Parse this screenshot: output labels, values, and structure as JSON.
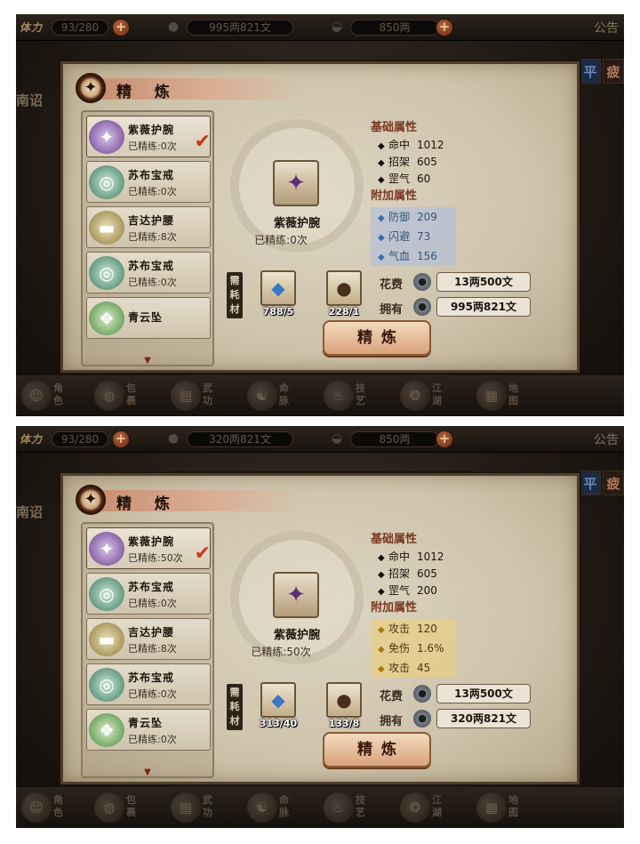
{
  "shots": [
    {
      "topbar": {
        "stamina_label": "体力",
        "stamina": "93/280",
        "money": "995两821文",
        "ingot": "850两",
        "notice": "公告"
      },
      "side_tabs": [
        "平",
        "疲"
      ],
      "left_edge": "南诏",
      "panel": {
        "title": "精 炼",
        "list": [
          {
            "name": "紫薇护腕",
            "count": "已精练:0次",
            "icon": "bracer-icon"
          },
          {
            "name": "苏布宝戒",
            "count": "已精练:0次",
            "icon": "ring-icon"
          },
          {
            "name": "吉达护腰",
            "count": "已精练:8次",
            "icon": "belt-icon"
          },
          {
            "name": "苏布宝戒",
            "count": "已精练:0次",
            "icon": "ring-icon"
          },
          {
            "name": "青云坠",
            "count": "",
            "icon": "pendant-icon"
          }
        ],
        "detail": {
          "name": "紫薇护腕",
          "count": "已精练:0次"
        },
        "base_heading": "基础属性",
        "base_attrs": [
          {
            "label": "命中",
            "value": "1012"
          },
          {
            "label": "招架",
            "value": "605"
          },
          {
            "label": "罡气",
            "value": "60"
          }
        ],
        "bonus_heading": "附加属性",
        "bonus_attrs": [
          {
            "label": "防御",
            "value": "209"
          },
          {
            "label": "闪避",
            "value": "73"
          },
          {
            "label": "气血",
            "value": "156"
          }
        ],
        "materials_label": "需耗材",
        "materials": [
          {
            "qty": "788/5",
            "icon": "crystal-icon"
          },
          {
            "qty": "228/1",
            "icon": "pouch-icon"
          }
        ],
        "cost_label": "花费",
        "cost": "13两500文",
        "own_label": "拥有",
        "own": "995两821文",
        "refine_button": "精炼"
      }
    },
    {
      "topbar": {
        "stamina_label": "体力",
        "stamina": "93/280",
        "money": "320两821文",
        "ingot": "850两",
        "notice": "公告"
      },
      "side_tabs": [
        "平",
        "疲"
      ],
      "left_edge": "南诏",
      "panel": {
        "title": "精 炼",
        "list": [
          {
            "name": "紫薇护腕",
            "count": "已精练:50次",
            "icon": "bracer-icon"
          },
          {
            "name": "苏布宝戒",
            "count": "已精练:0次",
            "icon": "ring-icon"
          },
          {
            "name": "吉达护腰",
            "count": "已精练:8次",
            "icon": "belt-icon"
          },
          {
            "name": "苏布宝戒",
            "count": "已精练:0次",
            "icon": "ring-icon"
          },
          {
            "name": "青云坠",
            "count": "已精练:0次",
            "icon": "pendant-icon"
          }
        ],
        "detail": {
          "name": "紫薇护腕",
          "count": "已精练:50次"
        },
        "base_heading": "基础属性",
        "base_attrs": [
          {
            "label": "命中",
            "value": "1012"
          },
          {
            "label": "招架",
            "value": "605"
          },
          {
            "label": "罡气",
            "value": "200"
          }
        ],
        "bonus_heading": "附加属性",
        "bonus_attrs": [
          {
            "label": "攻击",
            "value": "120"
          },
          {
            "label": "免伤",
            "value": "1.6%"
          },
          {
            "label": "攻击",
            "value": "45"
          }
        ],
        "materials_label": "需耗材",
        "materials": [
          {
            "qty": "313/40",
            "icon": "crystal-icon"
          },
          {
            "qty": "133/8",
            "icon": "pouch-icon"
          }
        ],
        "cost_label": "花费",
        "cost": "13两500文",
        "own_label": "拥有",
        "own": "320两821文",
        "refine_button": "精炼"
      }
    }
  ],
  "bottom_nav": [
    "角色",
    "包裹",
    "武功",
    "命脉",
    "技艺",
    "江湖",
    "地图"
  ],
  "colors": {
    "bonus_blue": "#aabee1",
    "bonus_gold": "#ecce78",
    "check_red": "#c93a12"
  }
}
